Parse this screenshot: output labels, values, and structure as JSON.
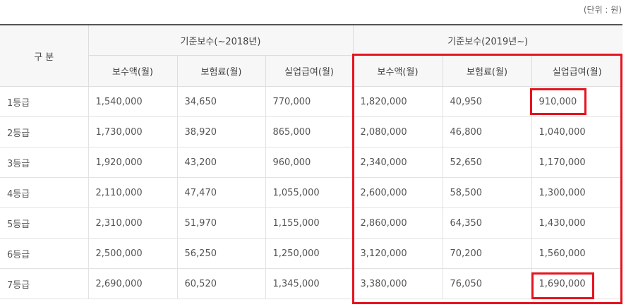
{
  "unit_label": "(단위 : 원)",
  "header": {
    "category": "구 분",
    "group_2018": "기준보수(~2018년)",
    "group_2019": "기준보수(2019년~)",
    "sub": [
      "보수액(월)",
      "보험료(월)",
      "실업급여(월)",
      "보수액(월)",
      "보험료(월)",
      "실업급여(월)"
    ]
  },
  "rows": [
    {
      "grade": "1등급",
      "values": [
        "1,540,000",
        "34,650",
        "770,000",
        "1,820,000",
        "40,950",
        "910,000"
      ]
    },
    {
      "grade": "2등급",
      "values": [
        "1,730,000",
        "38,920",
        "865,000",
        "2,080,000",
        "46,800",
        "1,040,000"
      ]
    },
    {
      "grade": "3등급",
      "values": [
        "1,920,000",
        "43,200",
        "960,000",
        "2,340,000",
        "52,650",
        "1,170,000"
      ]
    },
    {
      "grade": "4등급",
      "values": [
        "2,110,000",
        "47,470",
        "1,055,000",
        "2,600,000",
        "58,500",
        "1,300,000"
      ]
    },
    {
      "grade": "5등급",
      "values": [
        "2,310,000",
        "51,970",
        "1,155,000",
        "2,860,000",
        "64,350",
        "1,430,000"
      ]
    },
    {
      "grade": "6등급",
      "values": [
        "2,500,000",
        "56,250",
        "1,250,000",
        "3,120,000",
        "70,200",
        "1,560,000"
      ]
    },
    {
      "grade": "7등급",
      "values": [
        "2,690,000",
        "60,520",
        "1,345,000",
        "3,380,000",
        "76,050",
        "1,690,000"
      ]
    }
  ],
  "highlight_color": "#e5141f"
}
